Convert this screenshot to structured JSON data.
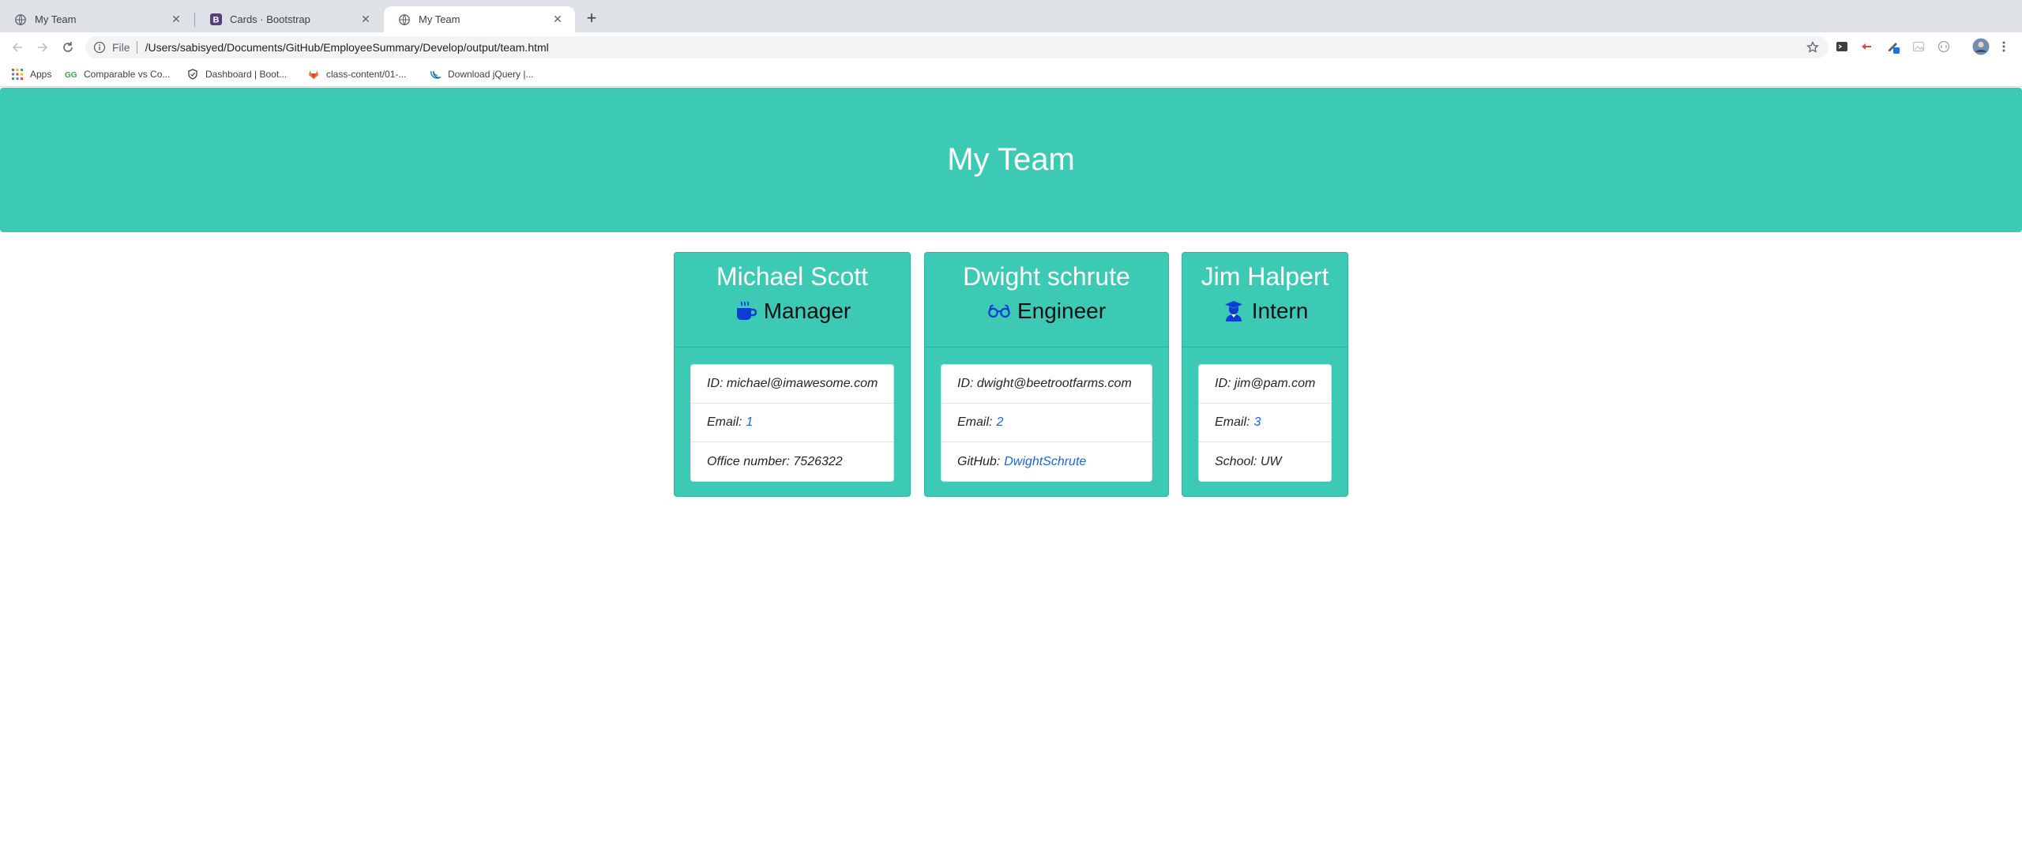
{
  "browser": {
    "tabs": [
      {
        "title": "My Team",
        "active": false
      },
      {
        "title": "Cards · Bootstrap",
        "active": false
      },
      {
        "title": "My Team",
        "active": true
      }
    ],
    "address": {
      "scheme": "File",
      "url": "/Users/sabisyed/Documents/GitHub/EmployeeSummary/Develop/output/team.html"
    },
    "bookmarks": [
      {
        "label": "Apps",
        "icon": "apps-grid-icon"
      },
      {
        "label": "Comparable vs Co...",
        "icon": "site-icon"
      },
      {
        "label": "Dashboard | Boot...",
        "icon": "shield-icon"
      },
      {
        "label": "class-content/01-...",
        "icon": "gitlab-icon"
      },
      {
        "label": "Download jQuery |...",
        "icon": "jquery-icon"
      }
    ]
  },
  "page": {
    "header_title": "My Team",
    "accent_color": "#3ccab5",
    "cards": [
      {
        "name": "Michael Scott",
        "role": "Manager",
        "role_icon": "coffee-mug-icon",
        "rows": [
          {
            "label": "ID:",
            "value": "michael@imawesome.com"
          },
          {
            "label": "Email:",
            "value": "1"
          },
          {
            "label": "Office number:",
            "value": "7526322"
          }
        ]
      },
      {
        "name": "Dwight schrute",
        "role": "Engineer",
        "role_icon": "glasses-icon",
        "rows": [
          {
            "label": "ID:",
            "value": "dwight@beetrootfarms.com"
          },
          {
            "label": "Email:",
            "value": "2"
          },
          {
            "label": "GitHub:",
            "value": "DwightSchrute"
          }
        ]
      },
      {
        "name": "Jim Halpert",
        "role": "Intern",
        "role_icon": "graduate-icon",
        "rows": [
          {
            "label": "ID:",
            "value": "jim@pam.com"
          },
          {
            "label": "Email:",
            "value": "3"
          },
          {
            "label": "School:",
            "value": "UW"
          }
        ]
      }
    ]
  }
}
